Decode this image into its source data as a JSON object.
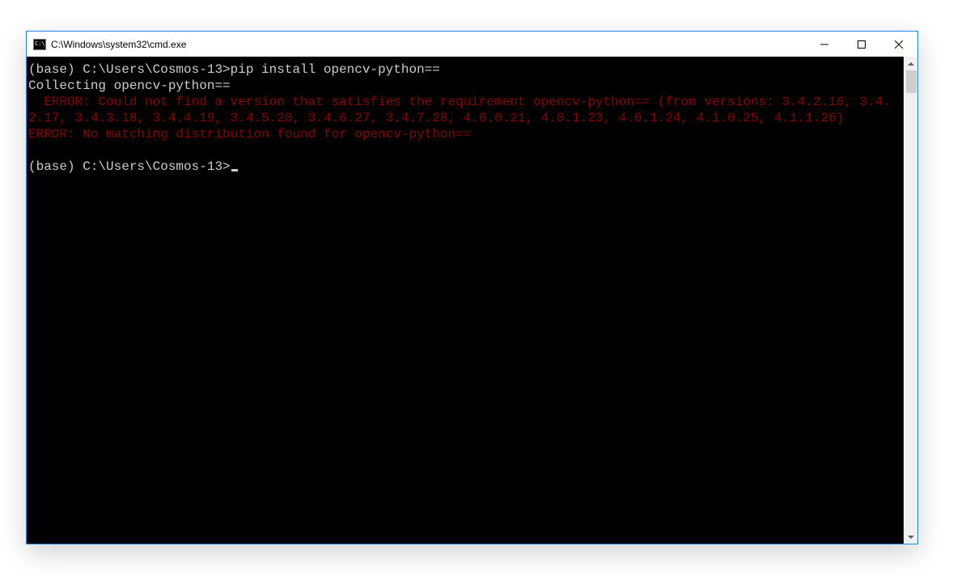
{
  "window": {
    "title": "C:\\Windows\\system32\\cmd.exe"
  },
  "terminal": {
    "line1_prompt": "(base) C:\\Users\\Cosmos-13>",
    "line1_cmd": "pip install opencv-python==",
    "line2": "Collecting opencv-python==",
    "err1": "  ERROR: Could not find a version that satisfies the requirement opencv-python== (from versions: 3.4.2.16, 3.4.2.17, 3.4.3.18, 3.4.4.19, 3.4.5.20, 3.4.6.27, 3.4.7.28, 4.0.0.21, 4.0.1.23, 4.0.1.24, 4.1.0.25, 4.1.1.26)",
    "err2": "ERROR: No matching distribution found for opencv-python==",
    "line_last_prompt": "(base) C:\\Users\\Cosmos-13>"
  }
}
